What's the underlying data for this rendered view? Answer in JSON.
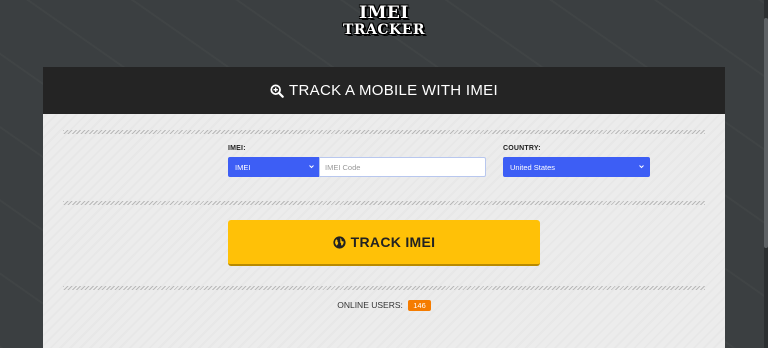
{
  "logo": {
    "line1": "IMEI",
    "line2": "TRACKER"
  },
  "header": {
    "title": "TRACK A MOBILE WITH IMEI",
    "icon": "search-plus-icon"
  },
  "form": {
    "imei_label": "IMEI:",
    "imei_type_value": "IMEI",
    "imei_input_placeholder": "IMEI Code",
    "country_label": "COUNTRY:",
    "country_value": "United States"
  },
  "track_button": {
    "label": "TRACK IMEI",
    "icon": "globe-icon"
  },
  "online": {
    "label": "ONLINE USERS:",
    "count": "146"
  },
  "colors": {
    "accent": "#ffc107",
    "select": "#3d5ef5",
    "badge": "#f57c00",
    "header_bg": "#242424"
  }
}
